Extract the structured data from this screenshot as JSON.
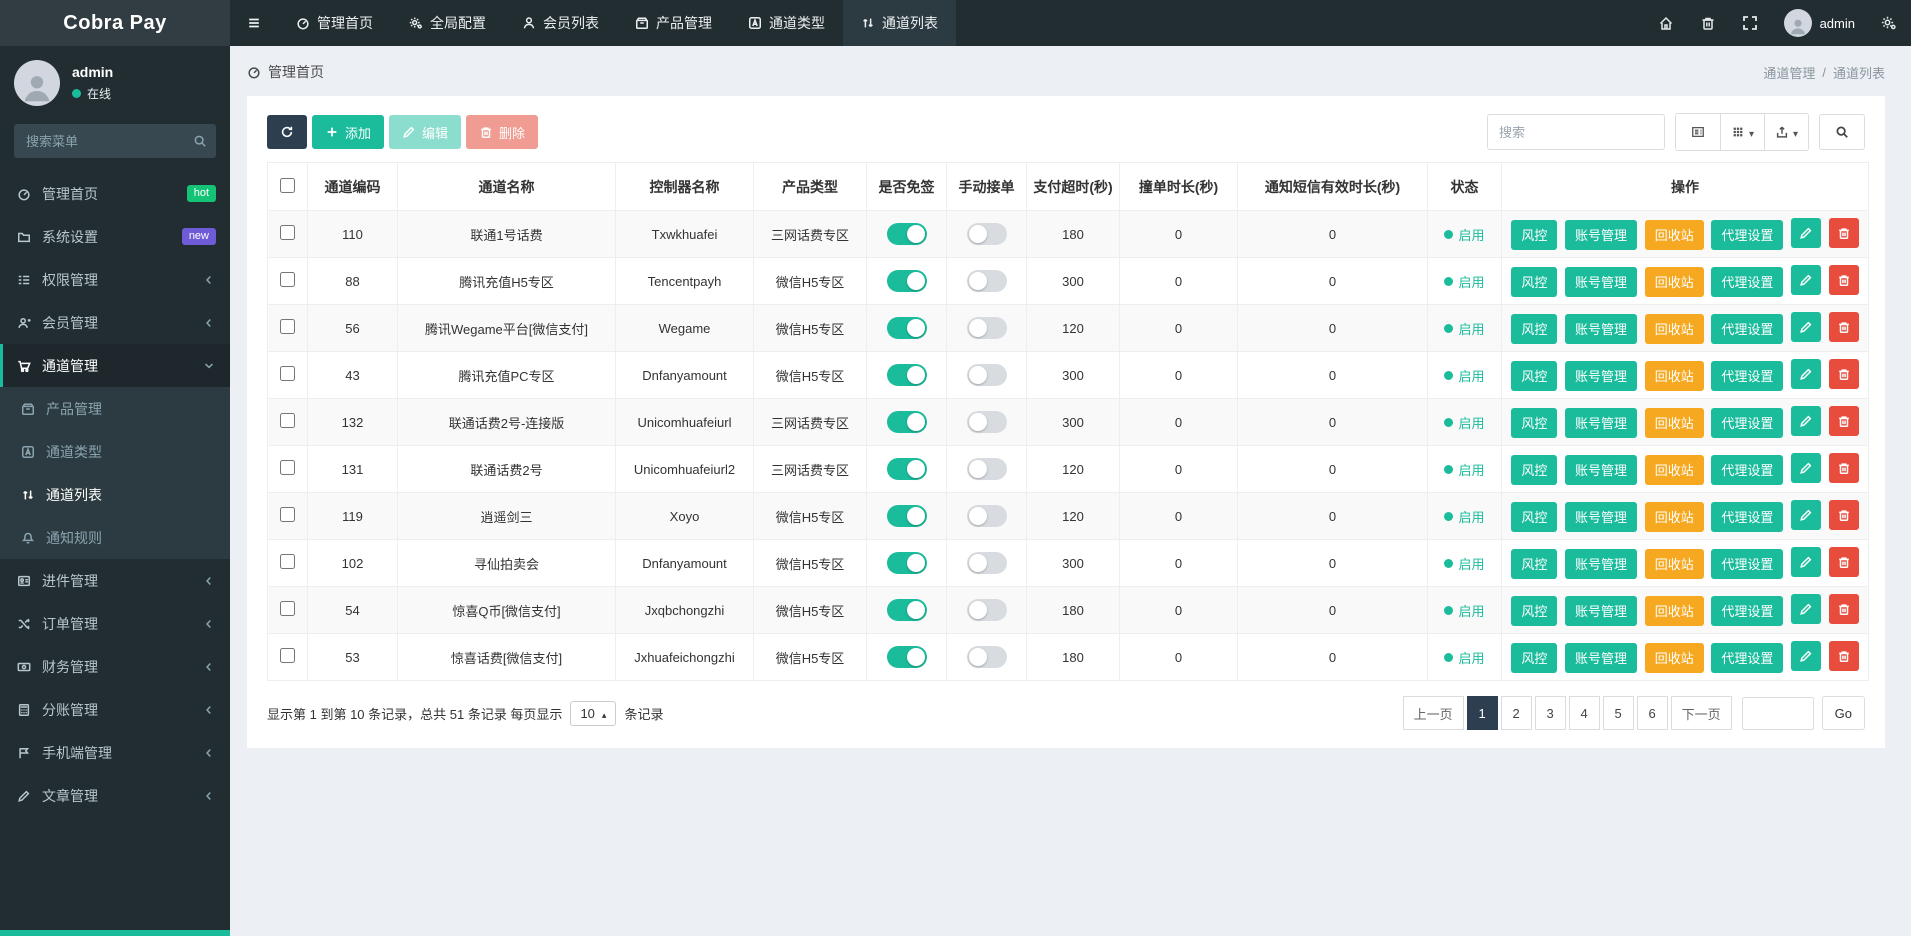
{
  "app": {
    "title": "Cobra Pay"
  },
  "topnav": {
    "items": [
      {
        "label": "管理首页",
        "icon": "gauge-icon"
      },
      {
        "label": "全局配置",
        "icon": "gears-icon"
      },
      {
        "label": "会员列表",
        "icon": "user-icon"
      },
      {
        "label": "产品管理",
        "icon": "box-icon"
      },
      {
        "label": "通道类型",
        "icon": "tag-icon"
      },
      {
        "label": "通道列表",
        "icon": "exchange-icon",
        "active": true
      }
    ],
    "user": "admin"
  },
  "sidebar": {
    "user": {
      "name": "admin",
      "status": "在线"
    },
    "search_placeholder": "搜索菜单",
    "items": [
      {
        "label": "管理首页",
        "badge": "hot"
      },
      {
        "label": "系统设置",
        "badge": "new"
      },
      {
        "label": "权限管理"
      },
      {
        "label": "会员管理"
      },
      {
        "label": "通道管理",
        "active": true,
        "children": [
          {
            "label": "产品管理"
          },
          {
            "label": "通道类型"
          },
          {
            "label": "通道列表",
            "active": true
          },
          {
            "label": "通知规则"
          }
        ]
      },
      {
        "label": "进件管理"
      },
      {
        "label": "订单管理"
      },
      {
        "label": "财务管理"
      },
      {
        "label": "分账管理"
      },
      {
        "label": "手机端管理"
      },
      {
        "label": "文章管理"
      }
    ]
  },
  "breadcrumb": {
    "left": "管理首页",
    "parent": "通道管理",
    "separator": "/",
    "current": "通道列表"
  },
  "toolbar": {
    "add_label": "添加",
    "edit_label": "编辑",
    "delete_label": "删除",
    "search_placeholder": "搜索"
  },
  "table": {
    "headers": [
      "通道编码",
      "通道名称",
      "控制器名称",
      "产品类型",
      "是否免签",
      "手动接单",
      "支付超时(秒)",
      "撞单时长(秒)",
      "通知短信有效时长(秒)",
      "状态",
      "操作"
    ],
    "actions": [
      "风控",
      "账号管理",
      "回收站",
      "代理设置"
    ],
    "rows": [
      {
        "code": "110",
        "name": "联通1号话费",
        "controller": "Txwkhuafei",
        "type": "三网话费专区",
        "free_sign": true,
        "manual": false,
        "timeout": "180",
        "collision": "0",
        "sms": "0",
        "status": "启用"
      },
      {
        "code": "88",
        "name": "腾讯充值H5专区",
        "controller": "Tencentpayh",
        "type": "微信H5专区",
        "free_sign": true,
        "manual": false,
        "timeout": "300",
        "collision": "0",
        "sms": "0",
        "status": "启用"
      },
      {
        "code": "56",
        "name": "腾讯Wegame平台[微信支付]",
        "controller": "Wegame",
        "type": "微信H5专区",
        "free_sign": true,
        "manual": false,
        "timeout": "120",
        "collision": "0",
        "sms": "0",
        "status": "启用"
      },
      {
        "code": "43",
        "name": "腾讯充值PC专区",
        "controller": "Dnfanyamount",
        "type": "微信H5专区",
        "free_sign": true,
        "manual": false,
        "timeout": "300",
        "collision": "0",
        "sms": "0",
        "status": "启用"
      },
      {
        "code": "132",
        "name": "联通话费2号-连接版",
        "controller": "Unicomhuafeiurl",
        "type": "三网话费专区",
        "free_sign": true,
        "manual": false,
        "timeout": "300",
        "collision": "0",
        "sms": "0",
        "status": "启用"
      },
      {
        "code": "131",
        "name": "联通话费2号",
        "controller": "Unicomhuafeiurl2",
        "type": "三网话费专区",
        "free_sign": true,
        "manual": false,
        "timeout": "120",
        "collision": "0",
        "sms": "0",
        "status": "启用"
      },
      {
        "code": "119",
        "name": "逍遥剑三",
        "controller": "Xoyo",
        "type": "微信H5专区",
        "free_sign": true,
        "manual": false,
        "timeout": "120",
        "collision": "0",
        "sms": "0",
        "status": "启用"
      },
      {
        "code": "102",
        "name": "寻仙拍卖会",
        "controller": "Dnfanyamount",
        "type": "微信H5专区",
        "free_sign": true,
        "manual": false,
        "timeout": "300",
        "collision": "0",
        "sms": "0",
        "status": "启用"
      },
      {
        "code": "54",
        "name": "惊喜Q币[微信支付]",
        "controller": "Jxqbchongzhi",
        "type": "微信H5专区",
        "free_sign": true,
        "manual": false,
        "timeout": "180",
        "collision": "0",
        "sms": "0",
        "status": "启用"
      },
      {
        "code": "53",
        "name": "惊喜话费[微信支付]",
        "controller": "Jxhuafeichongzhi",
        "type": "微信H5专区",
        "free_sign": true,
        "manual": false,
        "timeout": "180",
        "collision": "0",
        "sms": "0",
        "status": "启用"
      }
    ]
  },
  "pagination": {
    "summary_prefix": "显示第 1 到第 10 条记录，总共 51 条记录 每页显示",
    "page_size": "10",
    "summary_suffix": "条记录",
    "prev_label": "上一页",
    "next_label": "下一页",
    "pages": [
      "1",
      "2",
      "3",
      "4",
      "5",
      "6"
    ],
    "active_page": "1",
    "go_label": "Go"
  },
  "colors": {
    "topbar_bg": "#222d32",
    "logo_bg": "#323c43",
    "sidebar_bg": "#222d32",
    "submenu_bg": "#2c3b41",
    "accent_teal": "#1abc9c",
    "action_orange": "#f6a821",
    "action_red": "#e74c3c",
    "dark_navy": "#2c3e50",
    "badge_hot": "#15c377",
    "badge_new": "#6f5bd6",
    "content_bg": "#ecf0f5"
  }
}
